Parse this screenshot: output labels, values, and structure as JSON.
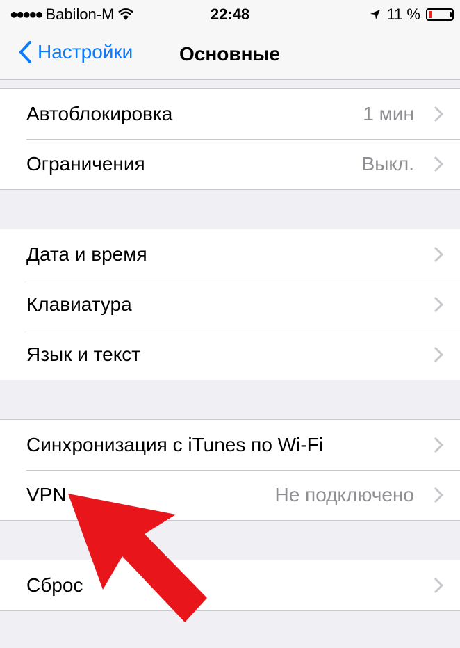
{
  "status_bar": {
    "signal_dots": "●●●●●",
    "carrier": "Babilon-M",
    "wifi_icon": "wifi-icon",
    "time": "22:48",
    "location_icon": "location-arrow-icon",
    "battery_percent": "11 %",
    "battery_level": 0.11,
    "battery_color": "#e3281e"
  },
  "nav": {
    "back_label": "Настройки",
    "title": "Основные",
    "accent": "#0a7aff"
  },
  "groups": [
    {
      "rows": [
        {
          "label": "Автоблокировка",
          "value": "1 мин"
        },
        {
          "label": "Ограничения",
          "value": "Выкл."
        }
      ]
    },
    {
      "rows": [
        {
          "label": "Дата и время",
          "value": ""
        },
        {
          "label": "Клавиатура",
          "value": ""
        },
        {
          "label": "Язык и текст",
          "value": ""
        }
      ]
    },
    {
      "rows": [
        {
          "label": "Синхронизация с iTunes по Wi-Fi",
          "value": ""
        },
        {
          "label": "VPN",
          "value": "Не подключено"
        }
      ]
    },
    {
      "rows": [
        {
          "label": "Сброс",
          "value": ""
        }
      ]
    }
  ],
  "annotation": {
    "arrow_color": "#e8151b",
    "points_to": "VPN"
  }
}
